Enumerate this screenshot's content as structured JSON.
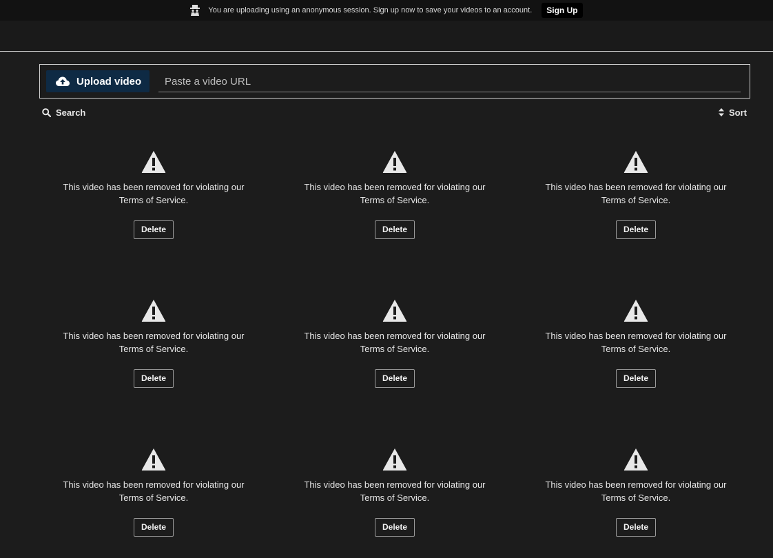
{
  "banner": {
    "icon": "incognito-icon",
    "text": "You are uploading using an anonymous session. Sign up now to save your videos to an account.",
    "signup_label": "Sign Up"
  },
  "upload": {
    "icon": "cloud-upload-icon",
    "button_label": "Upload video",
    "url_placeholder": "Paste a video URL",
    "url_value": ""
  },
  "toolbar": {
    "search_icon": "search-icon",
    "search_label": "Search",
    "sort_icon": "sort-icon",
    "sort_label": "Sort"
  },
  "videos": [
    {
      "icon": "warning-icon",
      "message": "This video has been removed for violating our Terms of Service.",
      "delete_label": "Delete"
    },
    {
      "icon": "warning-icon",
      "message": "This video has been removed for violating our Terms of Service.",
      "delete_label": "Delete"
    },
    {
      "icon": "warning-icon",
      "message": "This video has been removed for violating our Terms of Service.",
      "delete_label": "Delete"
    },
    {
      "icon": "warning-icon",
      "message": "This video has been removed for violating our Terms of Service.",
      "delete_label": "Delete"
    },
    {
      "icon": "warning-icon",
      "message": "This video has been removed for violating our Terms of Service.",
      "delete_label": "Delete"
    },
    {
      "icon": "warning-icon",
      "message": "This video has been removed for violating our Terms of Service.",
      "delete_label": "Delete"
    },
    {
      "icon": "warning-icon",
      "message": "This video has been removed for violating our Terms of Service.",
      "delete_label": "Delete"
    },
    {
      "icon": "warning-icon",
      "message": "This video has been removed for violating our Terms of Service.",
      "delete_label": "Delete"
    },
    {
      "icon": "warning-icon",
      "message": "This video has been removed for violating our Terms of Service.",
      "delete_label": "Delete"
    }
  ],
  "colors": {
    "background": "#1c1c1c",
    "banner_bg": "#121212",
    "upload_button_bg": "#0e2a44",
    "text": "#e6e6e6"
  }
}
